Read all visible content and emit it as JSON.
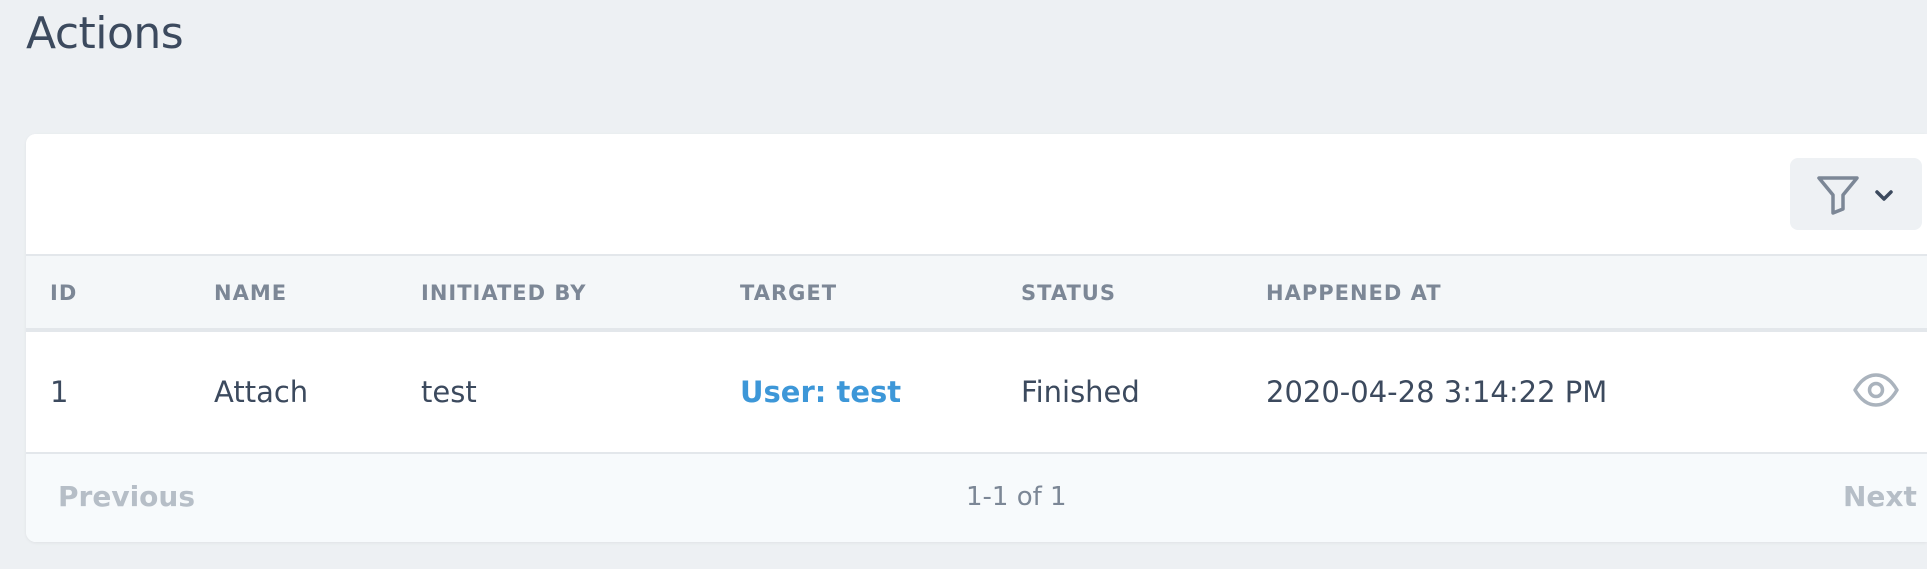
{
  "page": {
    "title": "Actions"
  },
  "toolbar": {
    "filter_icon": "funnel-icon",
    "dropdown_icon": "chevron-down-icon"
  },
  "table": {
    "columns": [
      "ID",
      "NAME",
      "INITIATED BY",
      "TARGET",
      "STATUS",
      "HAPPENED AT"
    ],
    "rows": [
      {
        "id": "1",
        "name": "Attach",
        "initiated_by": "test",
        "target": "User: test",
        "status": "Finished",
        "happened_at": "2020-04-28 3:14:22 PM",
        "action_icon": "eye-icon"
      }
    ]
  },
  "pagination": {
    "previous_label": "Previous",
    "info": "1-1 of 1",
    "next_label": "Next"
  },
  "colors": {
    "background": "#edf0f3",
    "link": "#3d97d8",
    "text": "#3c4a5e",
    "muted": "#7c8796",
    "disabled": "#b6bec7"
  }
}
